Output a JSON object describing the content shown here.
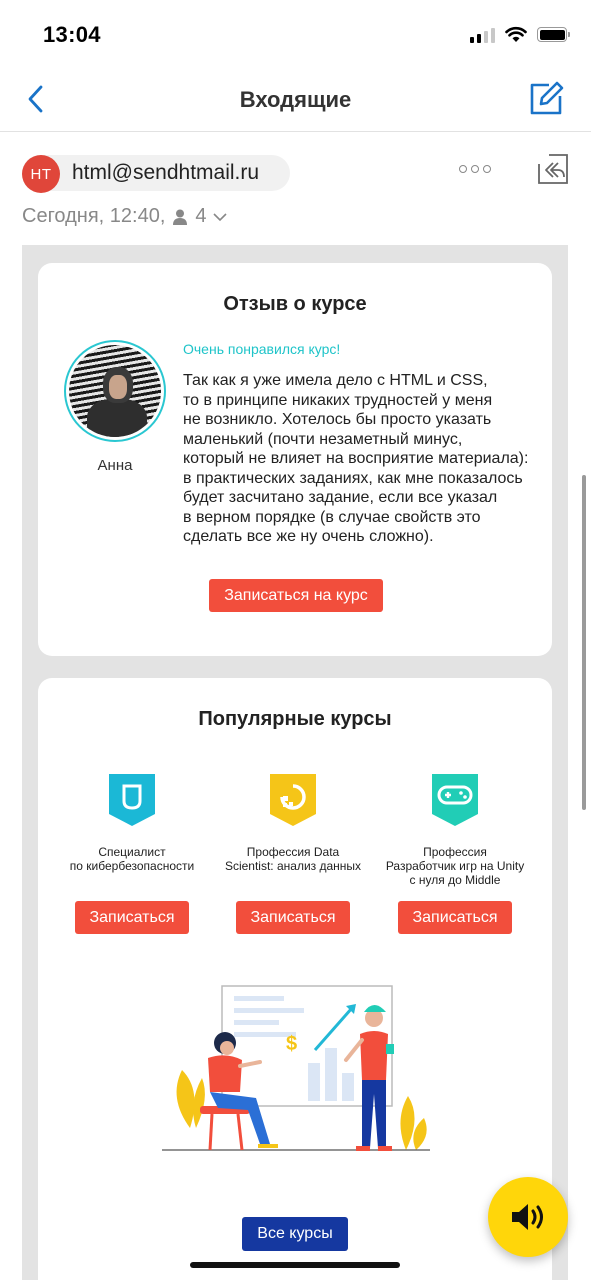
{
  "status_bar": {
    "time": "13:04"
  },
  "nav": {
    "title": "Входящие"
  },
  "message": {
    "sender_initials": "HT",
    "sender_email": "html@sendhtmail.ru",
    "date": "Сегодня, 12:40,",
    "recipients_count": "4"
  },
  "review": {
    "title": "Отзыв о курсе",
    "accent": "Очень понравился курс!",
    "text": "Так как я уже имела дело с HTML и CSS,\nто в принципе никаких трудностей у меня\nне возникло. Хотелось бы просто указать\nмаленький (почти незаметный минус,\nкоторый не влияет на восприятие материала):\nв практических заданиях, как мне показалось\nбудет засчитано задание, если все указал\nв верном порядке (в случае свойств это\nсделать все же ну очень сложно).",
    "reviewer": "Анна",
    "button": "Записаться на курс"
  },
  "popular": {
    "title": "Популярные курсы",
    "courses": [
      {
        "name": "Специалист\nпо кибербезопасности",
        "button": "Записаться",
        "icon": "shield-icon",
        "color": "#1bb8d6"
      },
      {
        "name": "Профессия Data\nScientist: анализ данных",
        "button": "Записаться",
        "icon": "data-icon",
        "color": "#f5c518"
      },
      {
        "name": "Профессия\nРазработчик игр на Unity\nс нуля до Middle",
        "button": "Записаться",
        "icon": "gamepad-icon",
        "color": "#21cdb6"
      }
    ],
    "all_button": "Все курсы"
  },
  "colors": {
    "accent_blue": "#1a73c8",
    "cta_red": "#f24e3c",
    "cta_blue": "#1538a0",
    "fab_yellow": "#ffd60a"
  }
}
